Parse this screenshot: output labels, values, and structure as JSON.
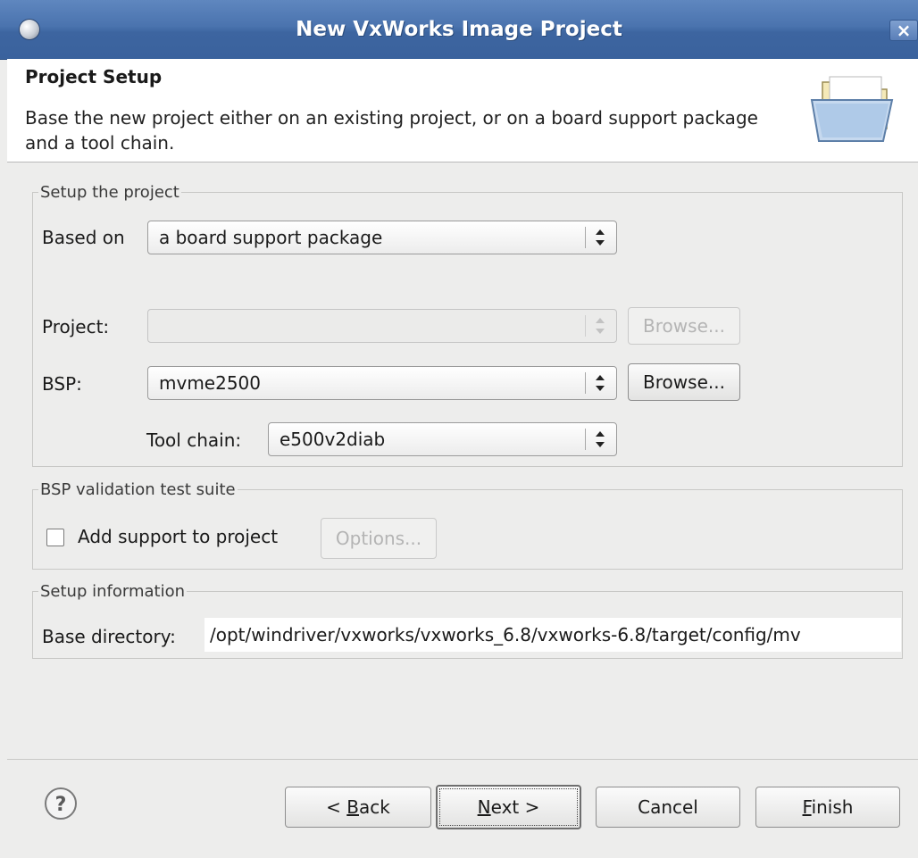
{
  "window": {
    "title": "New VxWorks Image Project",
    "close_glyph": "×"
  },
  "header": {
    "title": "Project Setup",
    "description": "Base the new project either on an existing project, or on a board support package and a tool chain.",
    "icon": "open-folder-icon"
  },
  "setup_group": {
    "legend": "Setup the project",
    "based_on_label": "Based on",
    "based_on_value": "a board support package",
    "project_label": "Project:",
    "project_value": "",
    "project_browse": "Browse...",
    "bsp_label": "BSP:",
    "bsp_value": "mvme2500",
    "bsp_browse": "Browse...",
    "toolchain_label": "Tool chain:",
    "toolchain_value": "e500v2diab"
  },
  "validation_group": {
    "legend": "BSP validation test suite",
    "checkbox_label": "Add support to project",
    "checkbox_checked": false,
    "options_button": "Options..."
  },
  "info_group": {
    "legend": "Setup information",
    "base_dir_label": "Base directory:",
    "base_dir_value": "/opt/windriver/vxworks/vxworks_6.8/vxworks-6.8/target/config/mv"
  },
  "footer": {
    "help_icon": "help-icon",
    "back_prefix": "< ",
    "back_mnemonic": "B",
    "back_rest": "ack",
    "next_mnemonic": "N",
    "next_rest": "ext >",
    "cancel": "Cancel",
    "finish_mnemonic": "F",
    "finish_rest": "inish"
  }
}
